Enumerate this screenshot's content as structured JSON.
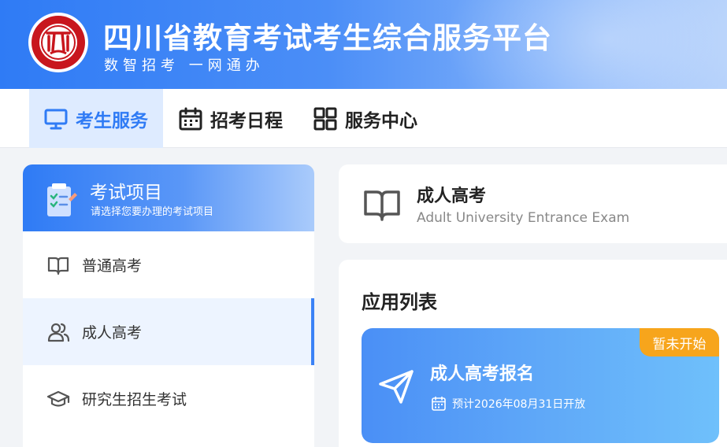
{
  "header": {
    "title": "四川省教育考试考生综合服务平台",
    "subtitle": "数智招考  一网通办"
  },
  "nav": {
    "items": [
      {
        "label": "考生服务",
        "icon": "monitor-icon",
        "active": true
      },
      {
        "label": "招考日程",
        "icon": "calendar-icon",
        "active": false
      },
      {
        "label": "服务中心",
        "icon": "grid-icon",
        "active": false
      }
    ]
  },
  "sidebar": {
    "title": "考试项目",
    "subtitle": "请选择您要办理的考试项目",
    "items": [
      {
        "label": "普通高考",
        "icon": "book-open-icon",
        "active": false
      },
      {
        "label": "成人高考",
        "icon": "users-icon",
        "active": true
      },
      {
        "label": "研究生招生考试",
        "icon": "graduation-cap-icon",
        "active": false
      }
    ]
  },
  "exam": {
    "title": "成人高考",
    "subtitle_en": "Adult University Entrance Exam"
  },
  "apps": {
    "heading": "应用列表",
    "items": [
      {
        "name": "成人高考报名",
        "date": "预计2026年08月31日开放",
        "badge": "暂未开始"
      }
    ]
  },
  "colors": {
    "primary": "#2f7bf5",
    "badge": "#f7a51c",
    "logo_red": "#c8161d"
  }
}
